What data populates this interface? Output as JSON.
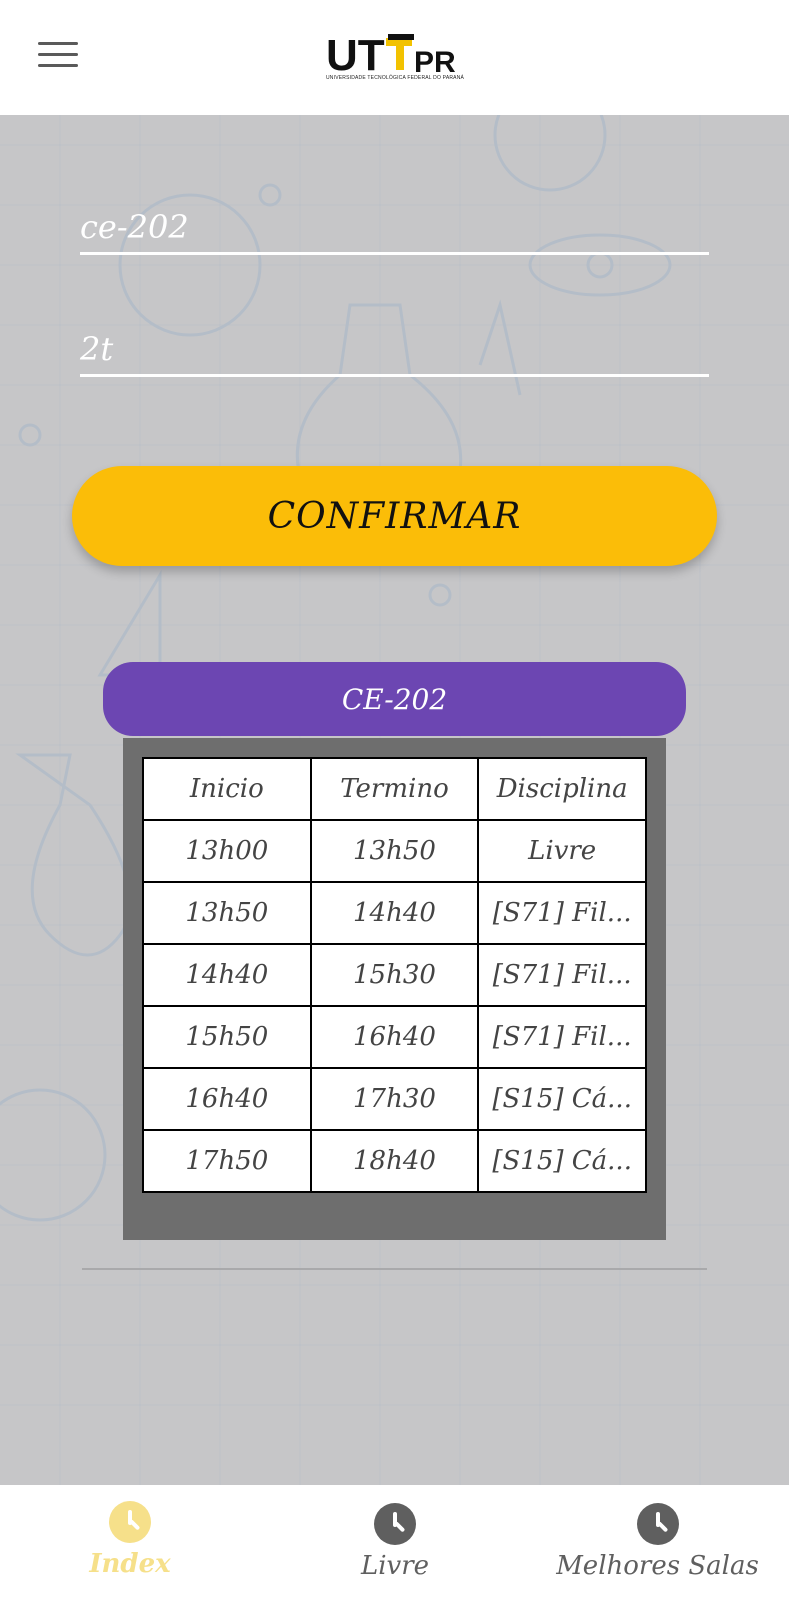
{
  "header": {
    "logo_main": "UTFPR",
    "logo_sub": "UNIVERSIDADE TECNOLÓGICA FEDERAL DO PARANÁ"
  },
  "form": {
    "room_value": "ce-202",
    "time_value": "2t",
    "confirm_label": "CONFIRMAR"
  },
  "schedule": {
    "room_title": "CE-202",
    "columns": [
      "Inicio",
      "Termino",
      "Disciplina"
    ],
    "rows": [
      [
        "13h00",
        "13h50",
        "Livre"
      ],
      [
        "13h50",
        "14h40",
        "[S71] Fil..."
      ],
      [
        "14h40",
        "15h30",
        "[S71] Fil..."
      ],
      [
        "15h50",
        "16h40",
        "[S71] Fil..."
      ],
      [
        "16h40",
        "17h30",
        "[S15] Cá..."
      ],
      [
        "17h50",
        "18h40",
        "[S15] Cá..."
      ]
    ]
  },
  "nav": {
    "items": [
      {
        "label": "Index",
        "icon": "clock-icon",
        "active": true
      },
      {
        "label": "Livre",
        "icon": "clock-icon",
        "active": false
      },
      {
        "label": "Melhores Salas",
        "icon": "clock-icon",
        "active": false
      }
    ]
  },
  "colors": {
    "accent_yellow": "#fbbd08",
    "room_purple": "#6c46b2",
    "active_nav": "#f6e08a",
    "inactive_nav": "#5f5f5f"
  }
}
